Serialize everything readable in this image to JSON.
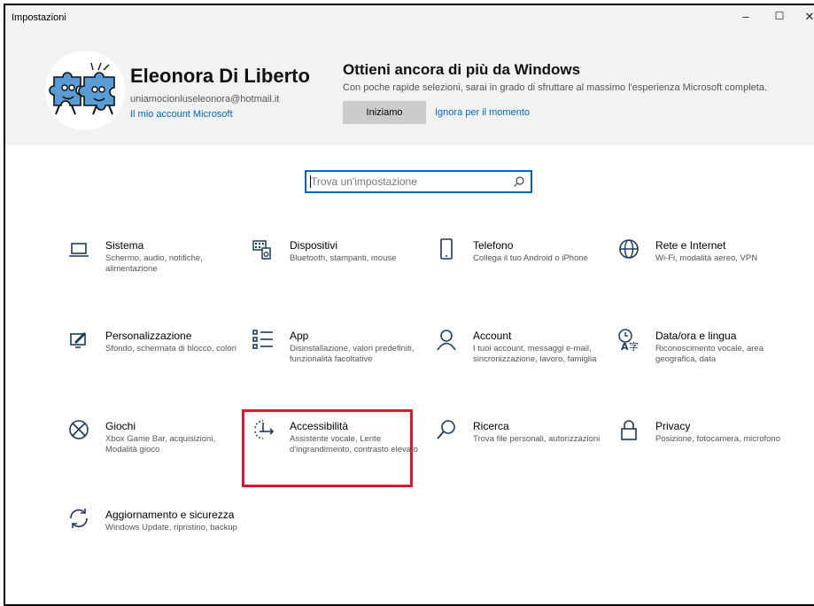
{
  "window": {
    "title": "Impostazioni",
    "controls": {
      "minimize": "–",
      "maximize": "☐",
      "close": "✕"
    }
  },
  "user": {
    "name": "Eleonora Di Liberto",
    "email": "uniamocionluseleonora@hotmail.it",
    "account_link": "Il mio account Microsoft"
  },
  "promo": {
    "title": "Ottieni ancora di più da Windows",
    "description": "Con poche rapide selezioni, sarai in grado di sfruttare al massimo l'esperienza Microsoft completa.",
    "start_button": "Iniziamo",
    "skip_link": "Ignora per il momento"
  },
  "search": {
    "placeholder": "Trova un'impostazione"
  },
  "tiles": [
    {
      "name": "Sistema",
      "desc": "Schermo, audio, notifiche, alimentazione",
      "icon": "laptop-icon"
    },
    {
      "name": "Dispositivi",
      "desc": "Bluetooth, stampanti, mouse",
      "icon": "devices-icon"
    },
    {
      "name": "Telefono",
      "desc": "Collega il tuo Android o iPhone",
      "icon": "phone-icon"
    },
    {
      "name": "Rete e Internet",
      "desc": "Wi-Fi, modalità aereo, VPN",
      "icon": "globe-icon"
    },
    {
      "name": "Personalizzazione",
      "desc": "Sfondo, schermata di blocco, colori",
      "icon": "paint-icon"
    },
    {
      "name": "App",
      "desc": "Disinstallazione, valori predefiniti, funzionalità facoltative",
      "icon": "apps-list-icon"
    },
    {
      "name": "Account",
      "desc": "I tuoi account, messaggi e-mail, sincronizzazione, lavoro, famiglia",
      "icon": "person-icon"
    },
    {
      "name": "Data/ora e lingua",
      "desc": "Riconoscimento vocale, area geografica, data",
      "icon": "language-icon"
    },
    {
      "name": "Giochi",
      "desc": "Xbox Game Bar, acquisizioni, Modalità gioco",
      "icon": "xbox-icon"
    },
    {
      "name": "Accessibilità",
      "desc": "Assistente vocale, Lente d'ingrandimento, contrasto elevato",
      "icon": "accessibility-icon"
    },
    {
      "name": "Ricerca",
      "desc": "Trova file personali, autorizzazioni",
      "icon": "search-icon"
    },
    {
      "name": "Privacy",
      "desc": "Posizione, fotocamera, microfono",
      "icon": "lock-icon"
    },
    {
      "name": "Aggiornamento e sicurezza",
      "desc": "Windows Update, ripristino, backup",
      "icon": "sync-icon"
    }
  ],
  "colors": {
    "accent": "#0067c0",
    "highlight": "#d9192d",
    "header_bg": "#f2f2f2"
  }
}
